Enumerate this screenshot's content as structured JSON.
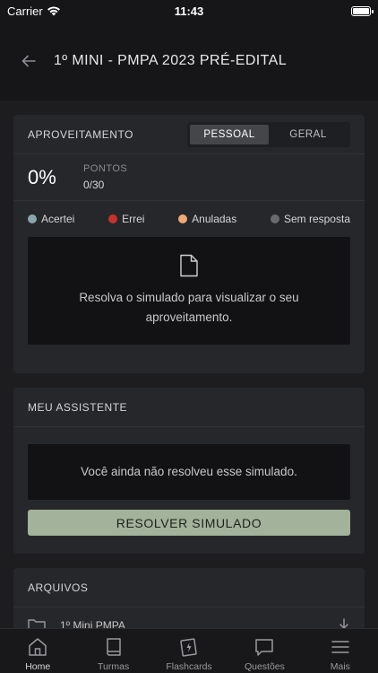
{
  "status_bar": {
    "carrier": "Carrier",
    "time": "11:43"
  },
  "header": {
    "title": "1º MINI - PMPA 2023 PRÉ-EDITAL"
  },
  "performance": {
    "title": "APROVEITAMENTO",
    "tabs": [
      "PESSOAL",
      "GERAL"
    ],
    "active_tab": "PESSOAL",
    "percent": "0%",
    "points_label": "PONTOS",
    "points_value": "0/30",
    "legend": [
      {
        "label": "Acertei",
        "color": "#8aa6ad"
      },
      {
        "label": "Errei",
        "color": "#c8322c"
      },
      {
        "label": "Anuladas",
        "color": "#f0a976"
      },
      {
        "label": "Sem resposta",
        "color": "#6a6a6c"
      }
    ],
    "empty_message": "Resolva o simulado para visualizar o seu aproveitamento."
  },
  "assistant": {
    "title": "MEU ASSISTENTE",
    "message": "Você ainda não resolveu esse simulado.",
    "button_label": "RESOLVER SIMULADO"
  },
  "files": {
    "title": "ARQUIVOS",
    "items": [
      {
        "name": "1º Mini PMPA"
      }
    ]
  },
  "tabbar": {
    "items": [
      {
        "label": "Home",
        "icon": "home-icon"
      },
      {
        "label": "Turmas",
        "icon": "book-icon"
      },
      {
        "label": "Flashcards",
        "icon": "flashcards-icon"
      },
      {
        "label": "Questões",
        "icon": "chat-bubble-icon"
      },
      {
        "label": "Mais",
        "icon": "menu-icon"
      }
    ],
    "active": "Home"
  },
  "colors": {
    "background": "#1d1d1f",
    "card": "#26272a",
    "accent_button": "#a3b29a"
  }
}
